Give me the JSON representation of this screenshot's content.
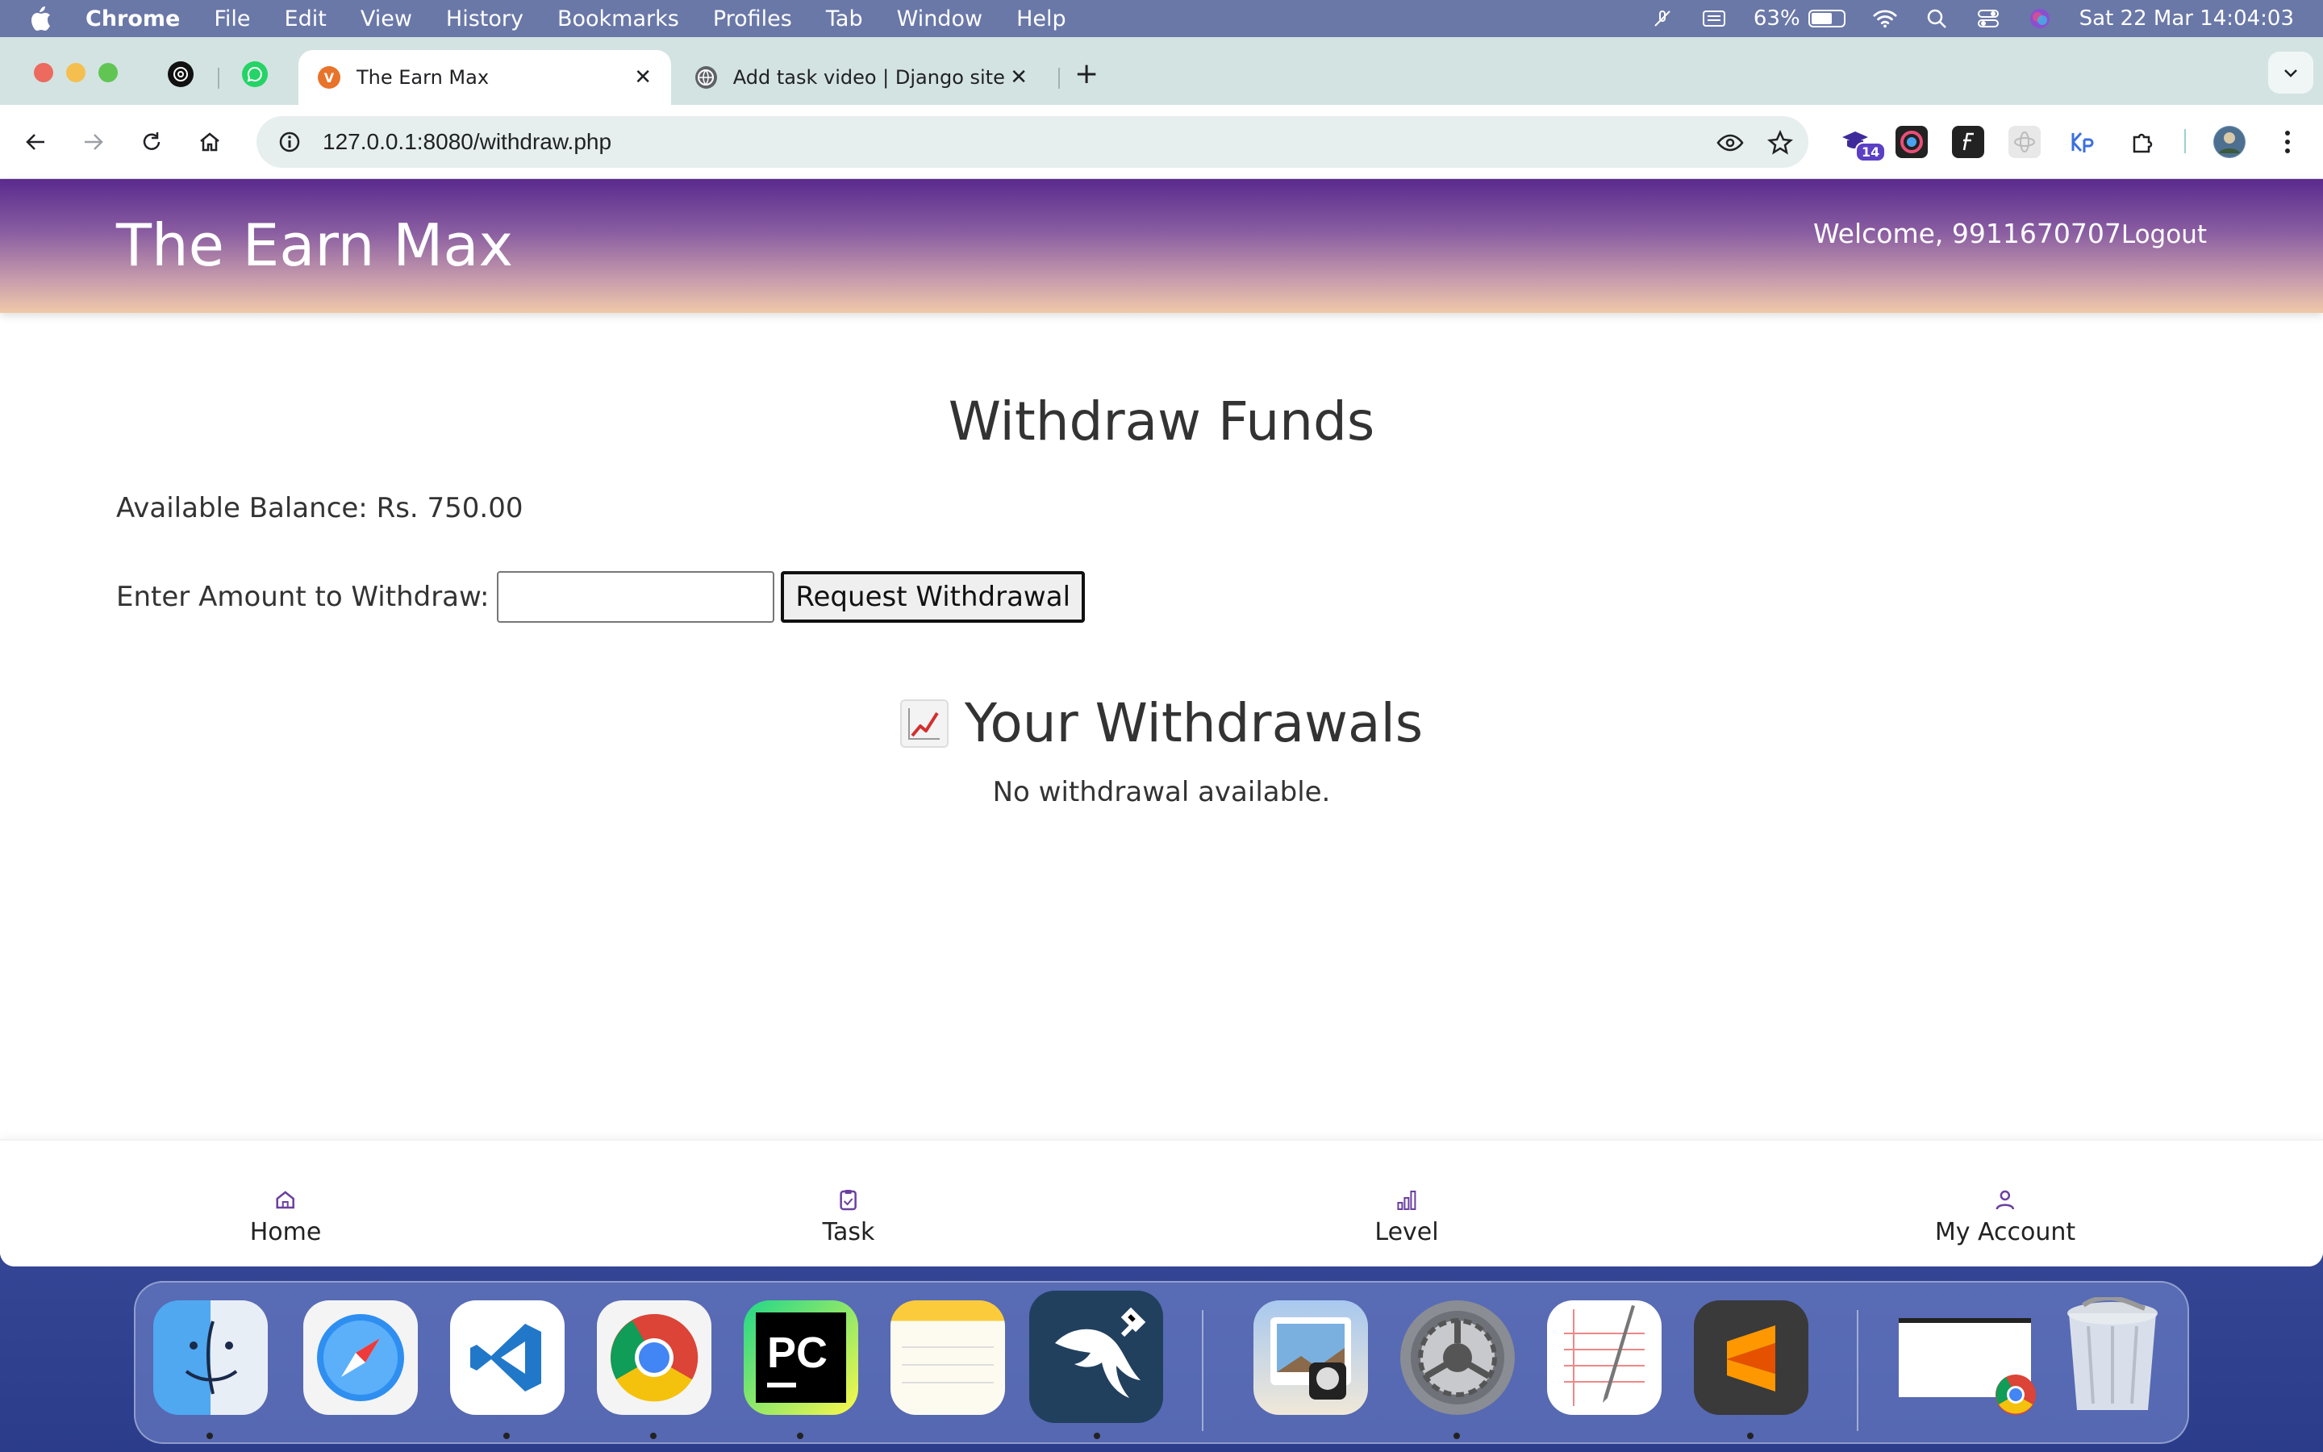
{
  "menubar": {
    "app": "Chrome",
    "items": [
      "File",
      "Edit",
      "View",
      "History",
      "Bookmarks",
      "Profiles",
      "Tab",
      "Window",
      "Help"
    ],
    "battery": "63%",
    "datetime": "Sat 22 Mar  14:04:03"
  },
  "browser": {
    "tabs": [
      {
        "title": "The Earn Max",
        "active": true
      },
      {
        "title": "Add task video | Django site a",
        "active": false
      }
    ],
    "url": "127.0.0.1:8080/withdraw.php",
    "extension_badge": "14"
  },
  "site": {
    "title": "The Earn Max",
    "welcome": "Welcome, 9911670707",
    "logout": "Logout"
  },
  "withdraw": {
    "heading": "Withdraw Funds",
    "balance": "Available Balance: Rs. 750.00",
    "amount_label": "Enter Amount to Withdraw:",
    "amount_value": "",
    "button": "Request Withdrawal",
    "history_heading": "Your Withdrawals",
    "empty_message": "No withdrawal available."
  },
  "bottom_nav": [
    {
      "label": "Home",
      "icon": "home-icon"
    },
    {
      "label": "Task",
      "icon": "clipboard-icon"
    },
    {
      "label": "Level",
      "icon": "bar-chart-icon"
    },
    {
      "label": "My Account",
      "icon": "user-icon"
    }
  ],
  "colors": {
    "header_top": "#5a2a8e",
    "header_bottom": "#f0c9a8",
    "tab_strip": "#d3e3e2"
  }
}
